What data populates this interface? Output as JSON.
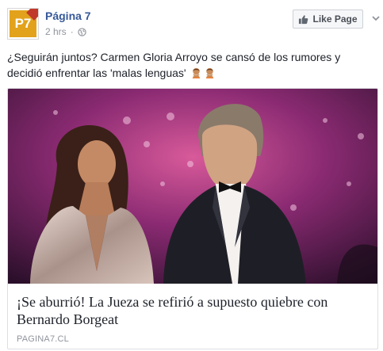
{
  "post": {
    "page_name": "Página 7",
    "avatar_text": "P7",
    "timestamp": "2 hrs",
    "separator": "·",
    "like_button_label": "Like Page",
    "text": "¿Seguirán juntos? Carmen Gloria Arroyo se cansó de los rumores y decidió enfrentar las 'malas lenguas'",
    "text_emojis": [
      "person-gesturing-no-emoji",
      "person-gesturing-no-emoji"
    ],
    "icons": {
      "audience": "globe-icon",
      "like": "thumbs-up-icon",
      "options": "chevron-down-icon"
    }
  },
  "link_card": {
    "title": "¡Se aburrió! La Jueza se refirió a supuesto quiebre con Bernardo Borgeat",
    "domain": "PAGINA7.CL",
    "image_alt": "photo-woman-and-man-in-tuxedo"
  },
  "colors": {
    "link_blue": "#365899",
    "meta_gray": "#90949c",
    "text": "#1d2129",
    "border": "#dddfe2",
    "avatar_bg": "#e2a21c"
  }
}
